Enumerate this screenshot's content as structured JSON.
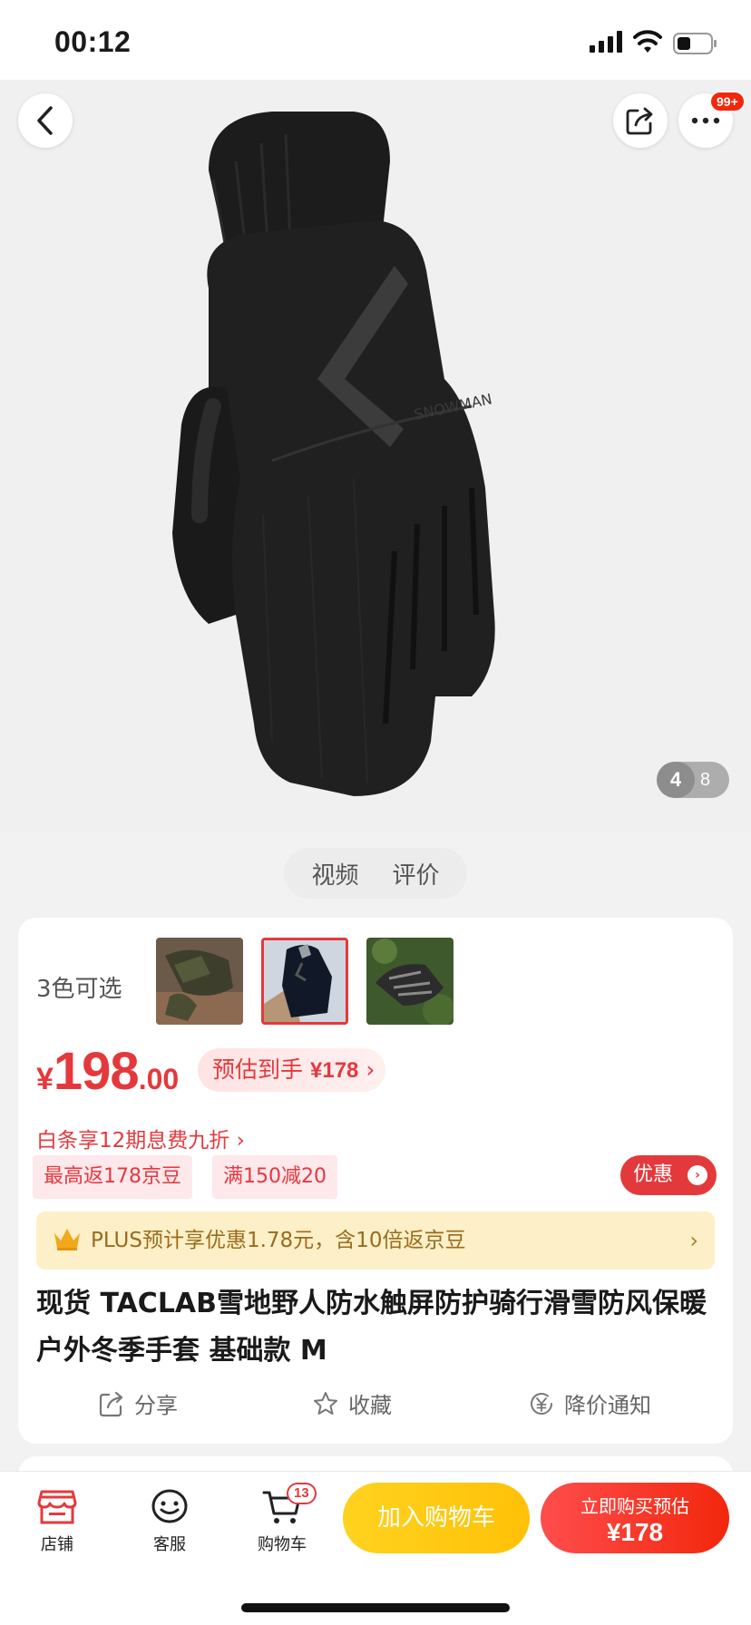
{
  "status": {
    "time": "00:12"
  },
  "hero": {
    "pager_current": "4",
    "pager_total": "8",
    "more_badge": "99+"
  },
  "media_tabs": [
    "视频",
    "评价"
  ],
  "product": {
    "colors_label": "3色可选",
    "price_symbol": "¥",
    "price_int": "198",
    "price_dec": ".00",
    "estimate_label": "预估到手",
    "estimate_value": "¥178",
    "estimate_chevron": "›",
    "baitiao": "白条享12期息费九折 ›",
    "tags": [
      "最高返178京豆",
      "满150减20"
    ],
    "promo_button": "优惠",
    "plus_text": "PLUS预计享优惠1.78元，含10倍返京豆",
    "plus_chevron": "›",
    "title": "现货 TACLAB雪地野人防水触屏防护骑行滑雪防风保暖户外冬季手套 基础款 M",
    "actions": [
      "分享",
      "收藏",
      "降价通知"
    ]
  },
  "bottom_bar": {
    "store": "店铺",
    "service": "客服",
    "cart": "购物车",
    "cart_count": "13",
    "add_to_cart": "加入购物车",
    "buy_line1": "立即购买预估",
    "buy_line2": "¥178"
  },
  "colors": {
    "accent": "#e4393c",
    "cart_yellow": "#ffc107",
    "plus_bg": "#fdf0c8"
  }
}
